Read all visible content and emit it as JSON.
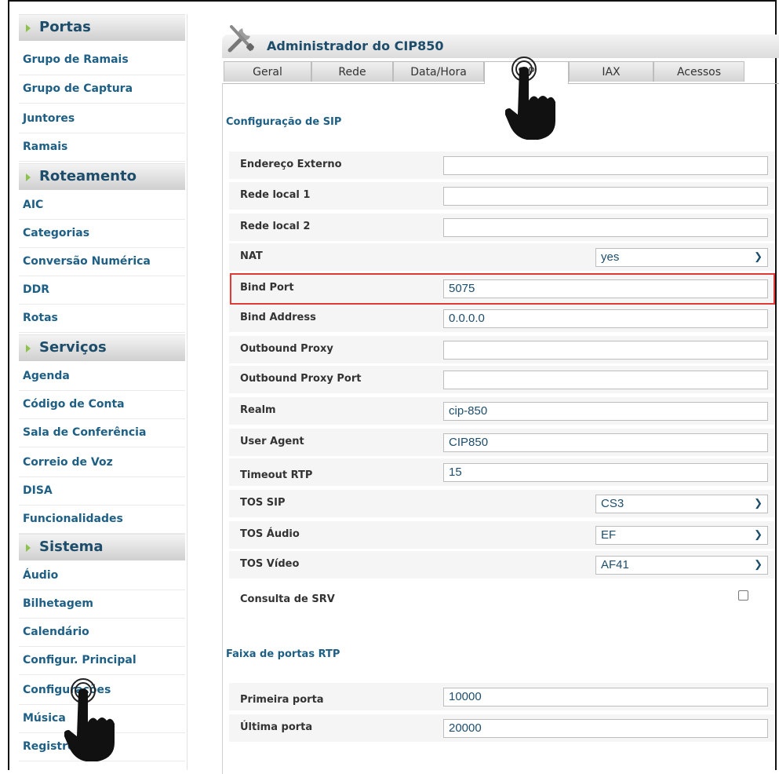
{
  "sidebar": {
    "sections": [
      {
        "title": "Portas",
        "items": [
          "Grupo de Ramais",
          "Grupo de Captura",
          "Juntores",
          "Ramais"
        ]
      },
      {
        "title": "Roteamento",
        "items": [
          "AIC",
          "Categorias",
          "Conversão Numérica",
          "DDR",
          "Rotas"
        ]
      },
      {
        "title": "Serviços",
        "items": [
          "Agenda",
          "Código de Conta",
          "Sala de Conferência",
          "Correio de Voz",
          "DISA",
          "Funcionalidades"
        ]
      },
      {
        "title": "Sistema",
        "items": [
          "Áudio",
          "Bilhetagem",
          "Calendário",
          "Configur. Principal",
          "Configurações",
          "Música",
          "Registros"
        ]
      }
    ]
  },
  "header": {
    "title": "Administrador do CIP850",
    "icon": "tools-icon"
  },
  "tabs": [
    {
      "label": "Geral"
    },
    {
      "label": "Rede"
    },
    {
      "label": "Data/Hora"
    },
    {
      "label": "SIP",
      "active": true
    },
    {
      "label": "IAX"
    },
    {
      "label": "Acessos"
    }
  ],
  "sip": {
    "section_title": "Configuração de SIP",
    "fields": {
      "endereco_externo": {
        "label": "Endereço Externo",
        "value": ""
      },
      "rede_local_1": {
        "label": "Rede local 1",
        "value": ""
      },
      "rede_local_2": {
        "label": "Rede local 2",
        "value": ""
      },
      "nat": {
        "label": "NAT",
        "value": "yes"
      },
      "bind_port": {
        "label": "Bind Port",
        "value": "5075"
      },
      "bind_address": {
        "label": "Bind Address",
        "value": "0.0.0.0"
      },
      "outbound_proxy": {
        "label": "Outbound Proxy",
        "value": ""
      },
      "outbound_proxy_port": {
        "label": "Outbound Proxy Port",
        "value": ""
      },
      "realm": {
        "label": "Realm",
        "value": "cip-850"
      },
      "user_agent": {
        "label": "User Agent",
        "value": "CIP850"
      },
      "timeout_rtp": {
        "label": "Timeout RTP",
        "value": "15"
      },
      "tos_sip": {
        "label": "TOS SIP",
        "value": "CS3"
      },
      "tos_audio": {
        "label": "TOS Áudio",
        "value": "EF"
      },
      "tos_video": {
        "label": "TOS Vídeo",
        "value": "AF41"
      },
      "consulta_srv": {
        "label": "Consulta de SRV",
        "checked": false
      }
    }
  },
  "rtp": {
    "section_title": "Faixa de portas RTP",
    "primeira_porta": {
      "label": "Primeira porta",
      "value": "10000"
    },
    "ultima_porta": {
      "label": "Última porta",
      "value": "20000"
    }
  },
  "colors": {
    "nav_text": "#1e5f86",
    "section_text": "#1d4d6a",
    "accent_triangle": "#8bc34a",
    "highlight": "#e53935"
  }
}
